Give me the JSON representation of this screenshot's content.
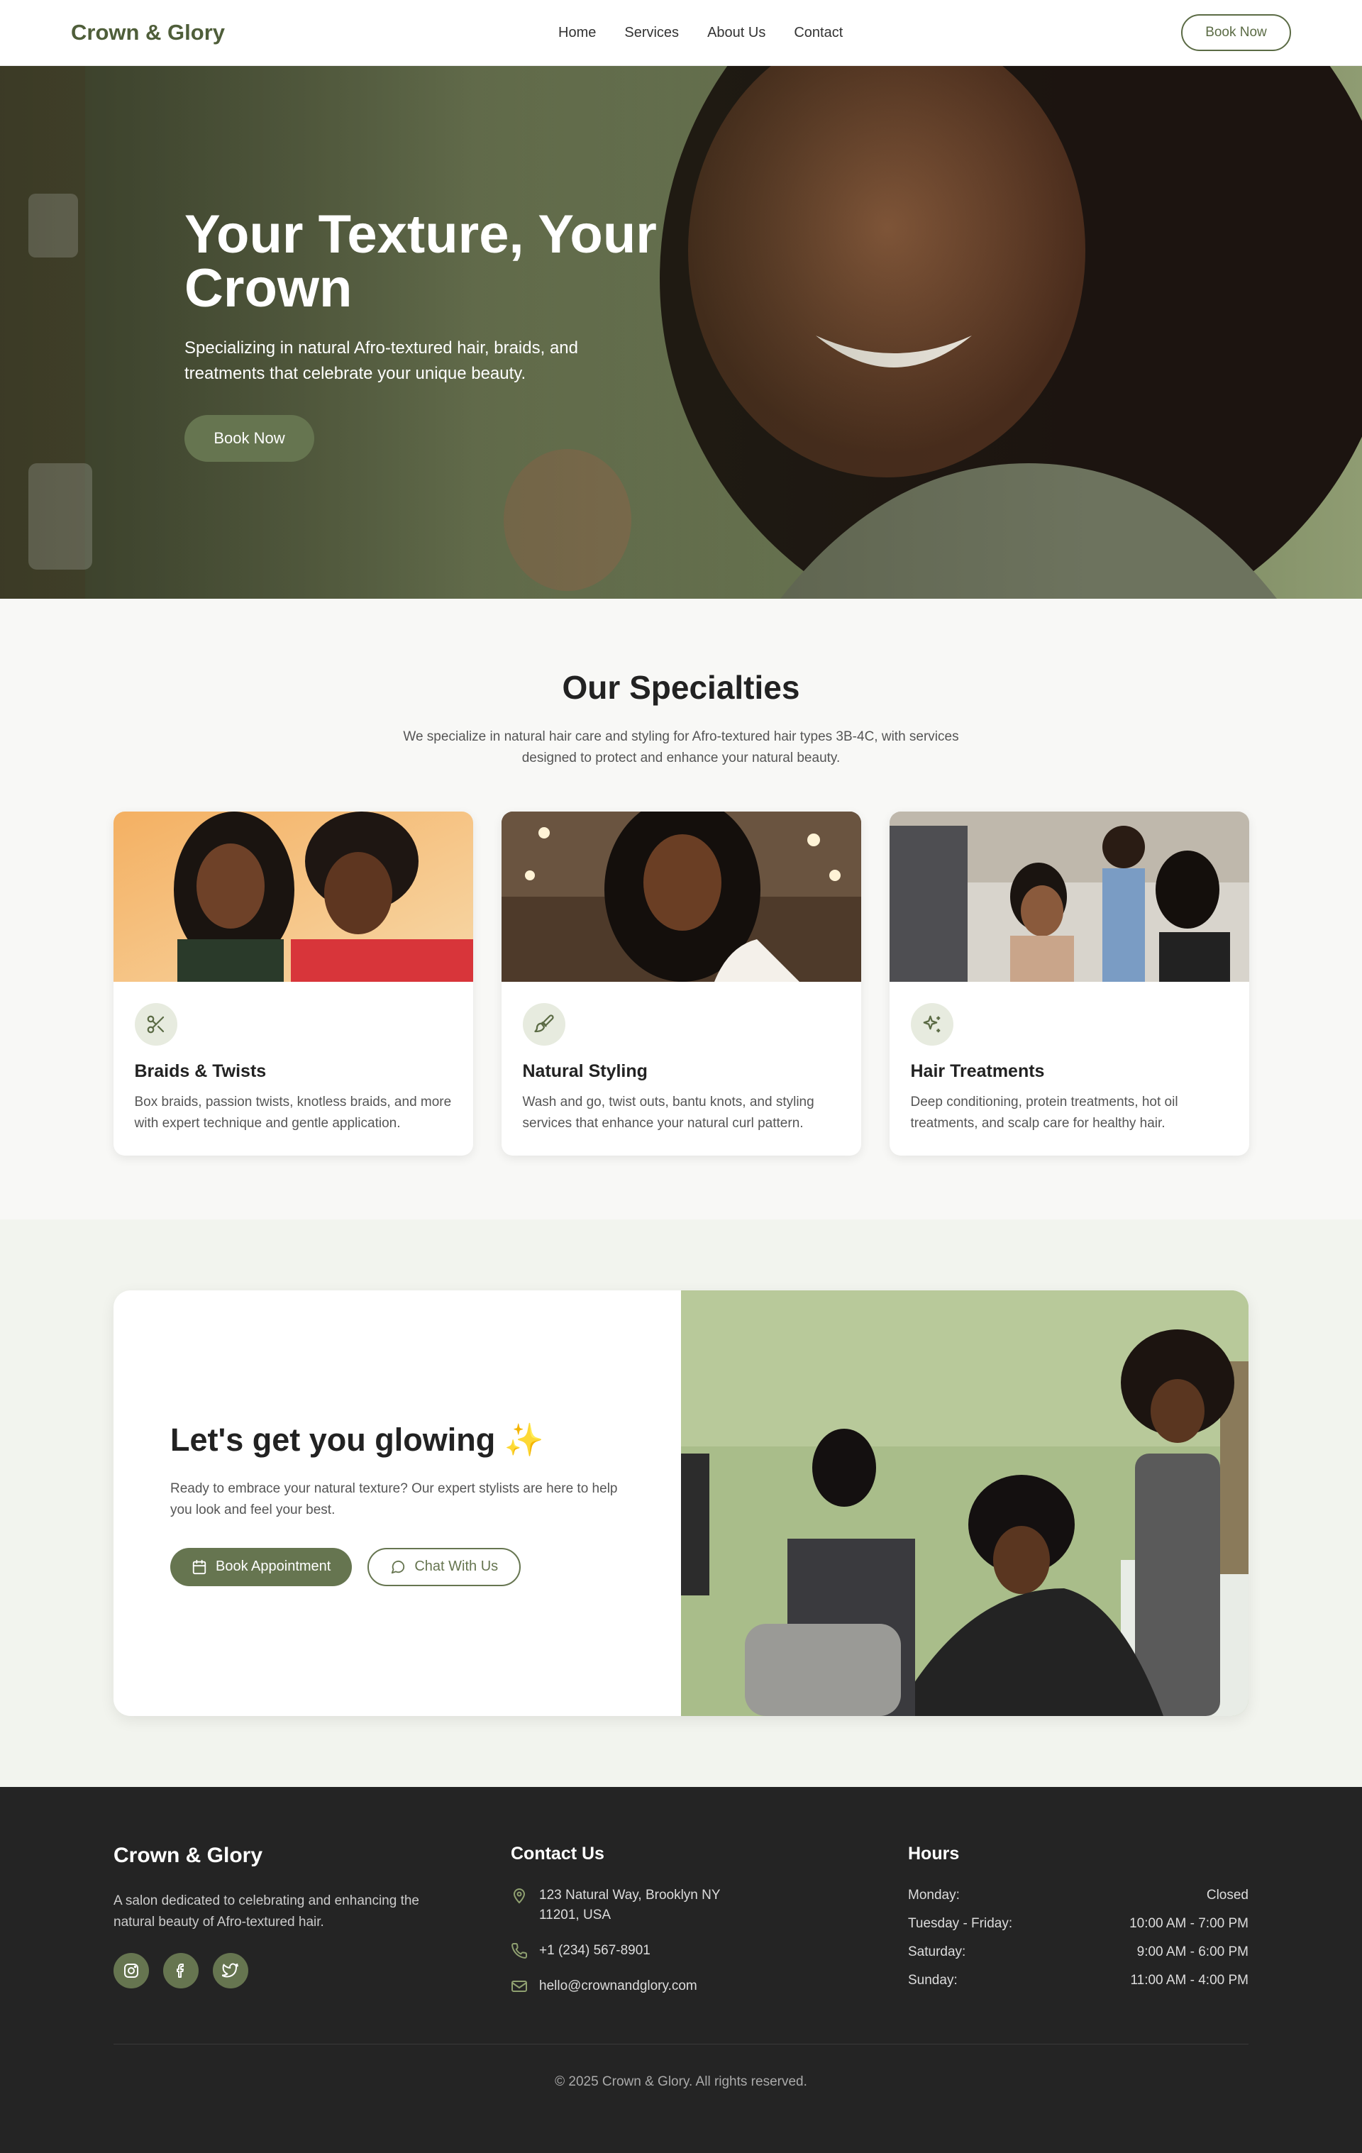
{
  "nav": {
    "brand": "Crown & Glory",
    "links": [
      "Home",
      "Services",
      "About Us",
      "Contact"
    ],
    "cta": "Book Now"
  },
  "hero": {
    "title": "Your Texture, Your Crown",
    "subtitle": "Specializing in natural Afro-textured hair, braids, and treatments that celebrate your unique beauty.",
    "button": "Book Now"
  },
  "specialties": {
    "title": "Our Specialties",
    "description": "We specialize in natural hair care and styling for Afro-textured hair types 3B-4C, with services designed to protect and enhance your natural beauty.",
    "cards": [
      {
        "icon": "scissors-icon",
        "title": "Braids & Twists",
        "text": "Box braids, passion twists, knotless braids, and more with expert technique and gentle application."
      },
      {
        "icon": "brush-icon",
        "title": "Natural Styling",
        "text": "Wash and go, twist outs, bantu knots, and styling services that enhance your natural curl pattern."
      },
      {
        "icon": "sparkles-icon",
        "title": "Hair Treatments",
        "text": "Deep conditioning, protein treatments, hot oil treatments, and scalp care for healthy hair."
      }
    ]
  },
  "cta": {
    "title": "Let's get you glowing ✨",
    "text": "Ready to embrace your natural texture? Our expert stylists are here to help you look and feel your best.",
    "primary": "Book Appointment",
    "secondary": "Chat With Us"
  },
  "footer": {
    "brand": "Crown & Glory",
    "description": "A salon dedicated to celebrating and enhancing the natural beauty of Afro-textured hair.",
    "contact_title": "Contact Us",
    "address": "123 Natural Way, Brooklyn NY 11201, USA",
    "phone": "+1 (234) 567-8901",
    "email": "hello@crownandglory.com",
    "hours_title": "Hours",
    "hours": [
      {
        "day": "Monday:",
        "time": "Closed"
      },
      {
        "day": "Tuesday - Friday:",
        "time": "10:00 AM - 7:00 PM"
      },
      {
        "day": "Saturday:",
        "time": "9:00 AM - 6:00 PM"
      },
      {
        "day": "Sunday:",
        "time": "11:00 AM - 4:00 PM"
      }
    ],
    "copyright": "© 2025 Crown & Glory. All rights reserved."
  },
  "colors": {
    "brand": "#4f5e3a",
    "accent": "#667550",
    "footer_bg": "#242424"
  }
}
